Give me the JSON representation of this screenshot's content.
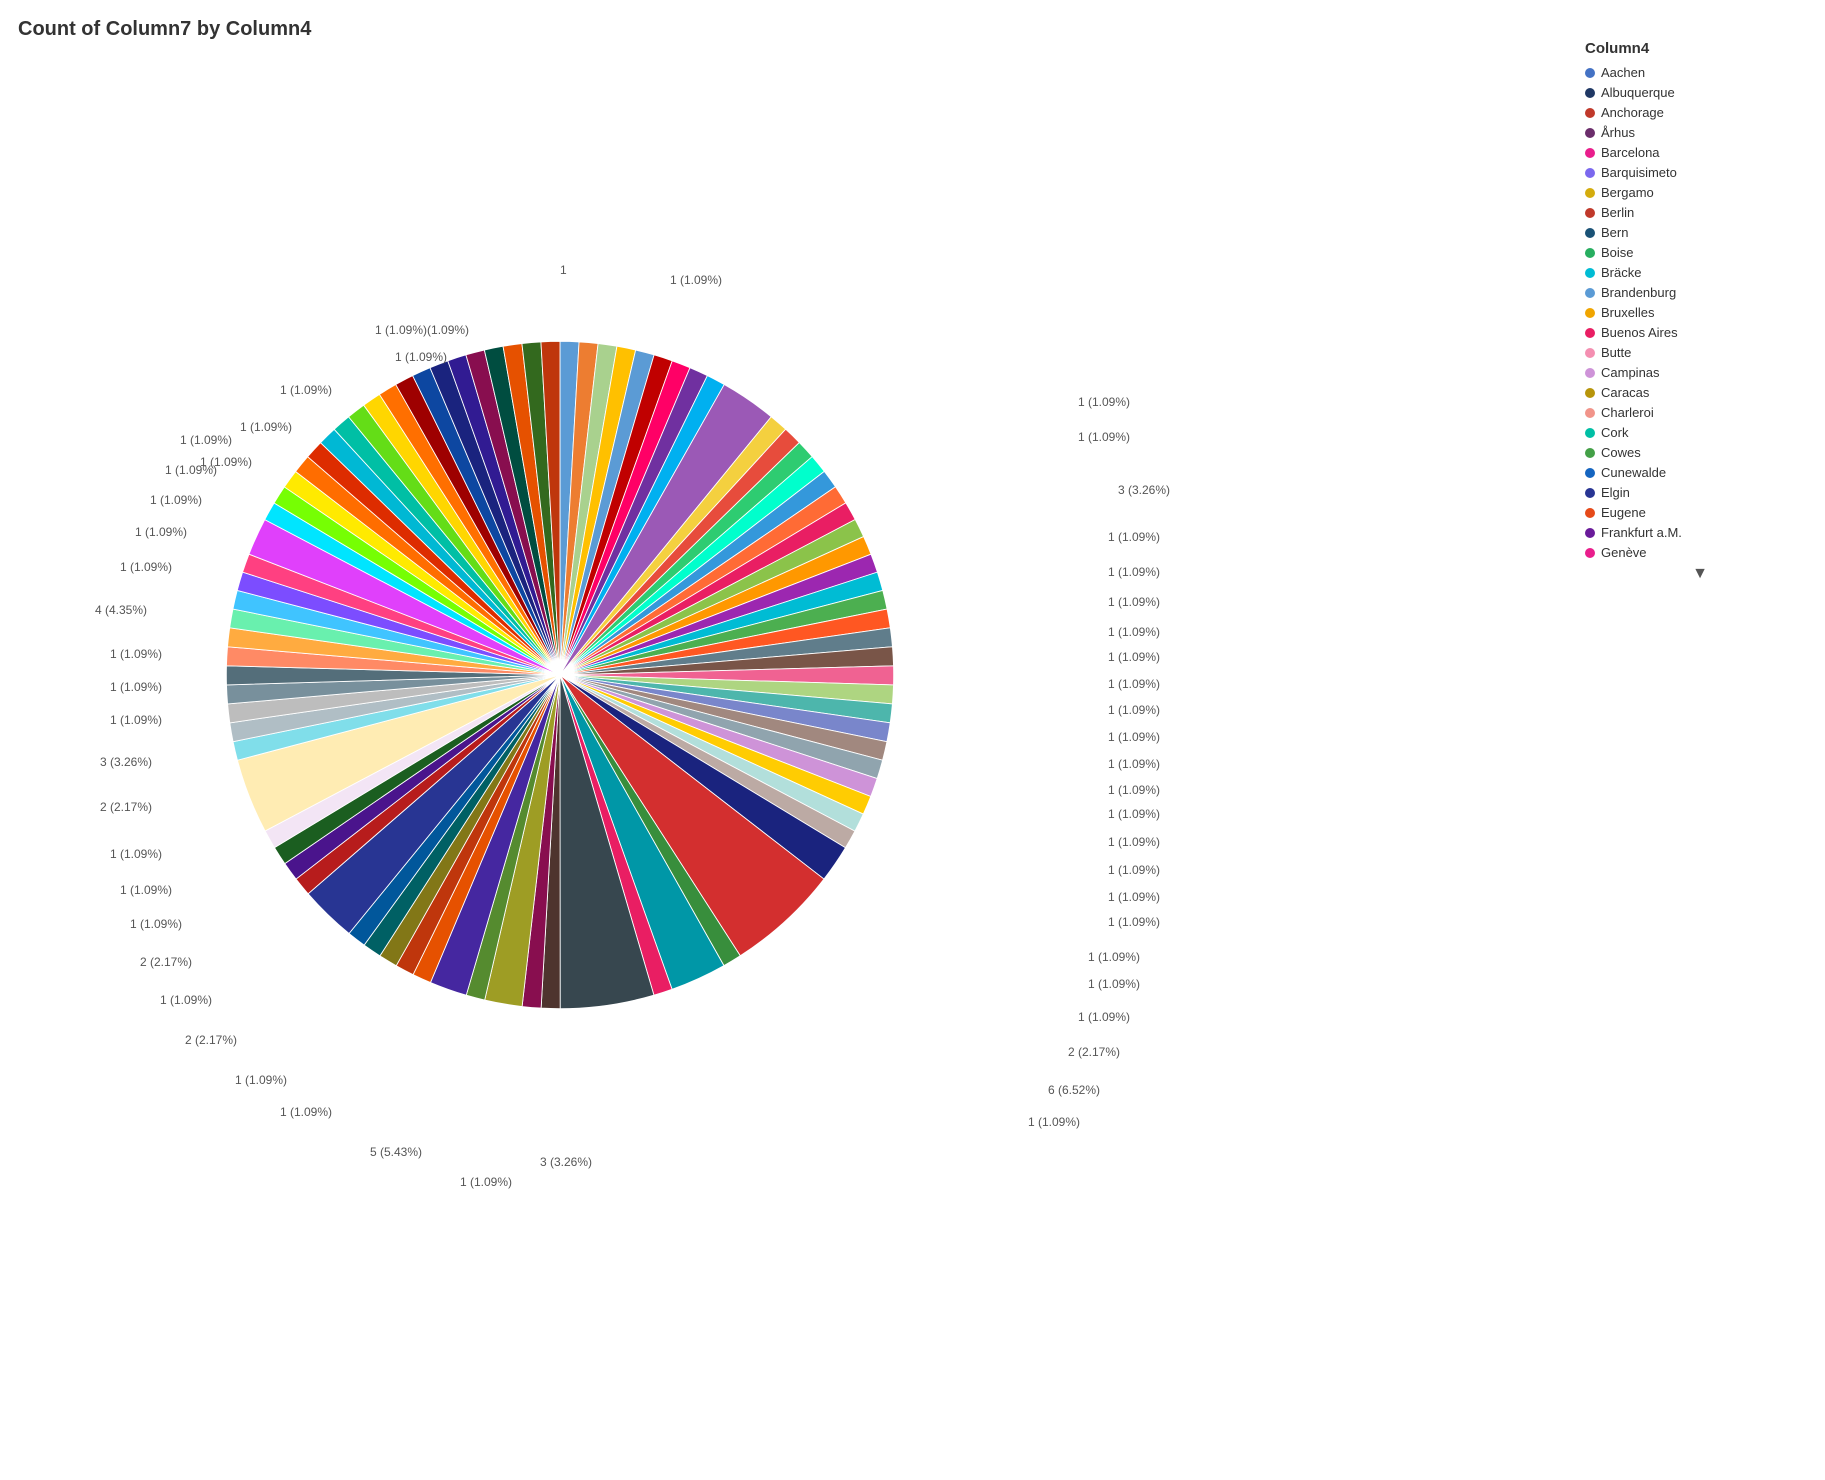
{
  "title": "Count of Column7 by Column4",
  "legend": {
    "title": "Column4",
    "items": [
      {
        "label": "Aachen",
        "color": "#4472C4"
      },
      {
        "label": "Albuquerque",
        "color": "#1F3864"
      },
      {
        "label": "Anchorage",
        "color": "#C0392B"
      },
      {
        "label": "Århus",
        "color": "#6B2D6B"
      },
      {
        "label": "Barcelona",
        "color": "#E91E8C"
      },
      {
        "label": "Barquisimeto",
        "color": "#7B68EE"
      },
      {
        "label": "Bergamo",
        "color": "#D4AC0D"
      },
      {
        "label": "Berlin",
        "color": "#C0392B"
      },
      {
        "label": "Bern",
        "color": "#1A5276"
      },
      {
        "label": "Boise",
        "color": "#27AE60"
      },
      {
        "label": "Bräcke",
        "color": "#00BCD4"
      },
      {
        "label": "Brandenburg",
        "color": "#5B9BD5"
      },
      {
        "label": "Bruxelles",
        "color": "#F0A500"
      },
      {
        "label": "Buenos Aires",
        "color": "#E91E63"
      },
      {
        "label": "Butte",
        "color": "#F48FB1"
      },
      {
        "label": "Campinas",
        "color": "#CE93D8"
      },
      {
        "label": "Caracas",
        "color": "#B7950B"
      },
      {
        "label": "Charleroi",
        "color": "#F1948A"
      },
      {
        "label": "Cork",
        "color": "#00BFA5"
      },
      {
        "label": "Cowes",
        "color": "#43A047"
      },
      {
        "label": "Cunewalde",
        "color": "#1565C0"
      },
      {
        "label": "Elgin",
        "color": "#283593"
      },
      {
        "label": "Eugene",
        "color": "#E64A19"
      },
      {
        "label": "Frankfurt a.M.",
        "color": "#6A1B9A"
      },
      {
        "label": "Genève",
        "color": "#E91E8C"
      }
    ]
  },
  "slices": [
    {
      "label": "1 (1.09%)",
      "color": "#4472C4",
      "startAngle": 0,
      "endAngle": 3.93
    },
    {
      "label": "1 (1.09%)",
      "color": "#1F3864",
      "startAngle": 3.93,
      "endAngle": 7.86
    },
    {
      "label": "1 (1.09%)",
      "color": "#C0392B",
      "startAngle": 7.86,
      "endAngle": 11.79
    },
    {
      "label": "3 (3.26%)",
      "color": "#E91E8C",
      "startAngle": 11.79,
      "endAngle": 23.58
    },
    {
      "label": "1 (1.09%)",
      "color": "#6B2D6B",
      "startAngle": 23.58,
      "endAngle": 27.51
    }
  ],
  "outerLabels": {
    "top": "1",
    "topRight": [
      "1 (1.09%)",
      "1 (1.09%)",
      "1 (1.09%)",
      "3 (3.26%)",
      "1 (1.09%)",
      "1 (1.09%)",
      "1 (1.09%)",
      "1 (1.09%)",
      "1 (1.09%)",
      "1 (1.09%)",
      "1 (1.09%)",
      "1 (1.09%)",
      "1 (1.09%)",
      "1 (1.09%)",
      "1 (1.09%)",
      "1 (1.09%)",
      "1 (1.09%)",
      "1 (1.09%)",
      "1 (1.09%)"
    ],
    "bottomRight": [
      "1 (1.09%)",
      "1 (1.09%)",
      "1 (1.09%)",
      "2 (2.17%)",
      "6 (6.52%)",
      "1 (1.09%)"
    ],
    "bottom": [
      "3 (3.26%)",
      "1 (1.09%)",
      "5 (5.43%)"
    ],
    "bottomLeft": [
      "1 (1.09%)",
      "1 (1.09%)",
      "2 (2.17%)",
      "1 (1.09%)",
      "2 (2.17%)",
      "1 (1.09%)",
      "1 (1.09%)",
      "1 (1.09%)"
    ],
    "left": [
      "2 (2.17%)",
      "3 (3.26%)",
      "1 (1.09%)",
      "1 (1.09%)",
      "1 (1.09%)",
      "4 (4.35%)",
      "1 (1.09%)",
      "1 (1.09%)",
      "1 (1.09%)",
      "1 (1.09%)",
      "1 (1.09%)"
    ],
    "topLeft": [
      "1 (1.09%)",
      "1 (1.09%)",
      "1 (1.09%)(1.09%)",
      "1"
    ]
  }
}
